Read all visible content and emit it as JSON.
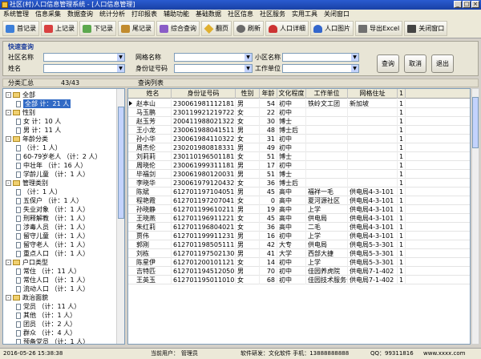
{
  "window": {
    "title": "社区(村)人口信息管理系统 - [人口信息管理]"
  },
  "menu": [
    "系统管理",
    "信息采集",
    "数据查询",
    "统计分析",
    "打印报表",
    "辅助功能",
    "基础数据",
    "社区信息",
    "社区服务",
    "实用工具",
    "关闭窗口"
  ],
  "toolbar": [
    "首记录",
    "上记录",
    "下记录",
    "尾记录",
    "综合查询",
    "翻页",
    "刷新",
    "人口详细",
    "人口图片",
    "导出Excel",
    "关闭窗口"
  ],
  "search": {
    "legend": "快速查询",
    "fields": [
      {
        "label": "社区名称",
        "value": ""
      },
      {
        "label": "姓名",
        "value": ""
      },
      {
        "label": "网格名称",
        "value": ""
      },
      {
        "label": "身份证号码",
        "value": ""
      },
      {
        "label": "小区名称",
        "value": ""
      },
      {
        "label": "工作单位",
        "value": ""
      }
    ],
    "buttons": [
      "查询",
      "取消",
      "退出"
    ]
  },
  "stats": {
    "tree_title": "分类汇总",
    "count": "43/43",
    "list_title": "查询列表"
  },
  "tree": [
    {
      "t": "全部",
      "lvl": 0,
      "kind": "folder",
      "exp": "-"
    },
    {
      "t": "全部    计：21 人",
      "lvl": 1,
      "kind": "page",
      "sel": true
    },
    {
      "t": "性别",
      "lvl": 0,
      "kind": "folder",
      "exp": "-"
    },
    {
      "t": "女   计：10 人",
      "lvl": 1,
      "kind": "page"
    },
    {
      "t": "男   计：11 人",
      "lvl": 1,
      "kind": "page"
    },
    {
      "t": "年龄分类",
      "lvl": 0,
      "kind": "folder",
      "exp": "-"
    },
    {
      "t": "（计：1 人）",
      "lvl": 1,
      "kind": "page"
    },
    {
      "t": "60-79岁老人 （计：2 人）",
      "lvl": 1,
      "kind": "page"
    },
    {
      "t": "中壮年  （计：16 人）",
      "lvl": 1,
      "kind": "page"
    },
    {
      "t": "学龄儿童  （计：1 人）",
      "lvl": 1,
      "kind": "page"
    },
    {
      "t": "管理类别",
      "lvl": 0,
      "kind": "folder",
      "exp": "-"
    },
    {
      "t": "（计：1 人）",
      "lvl": 1,
      "kind": "page"
    },
    {
      "t": "五保户 （计：1 人）",
      "lvl": 1,
      "kind": "page"
    },
    {
      "t": "失业对象 （计：1 人）",
      "lvl": 1,
      "kind": "page"
    },
    {
      "t": "刑释解教 （计：1 人）",
      "lvl": 1,
      "kind": "page"
    },
    {
      "t": "涉毒人员 （计：1 人）",
      "lvl": 1,
      "kind": "page"
    },
    {
      "t": "留守儿童 （计：1 人）",
      "lvl": 1,
      "kind": "page"
    },
    {
      "t": "留守老人 （计：1 人）",
      "lvl": 1,
      "kind": "page"
    },
    {
      "t": "重点人口 （计：1 人）",
      "lvl": 1,
      "kind": "page"
    },
    {
      "t": "户口类型",
      "lvl": 0,
      "kind": "folder",
      "exp": "-"
    },
    {
      "t": "常住 （计：11 人）",
      "lvl": 1,
      "kind": "page"
    },
    {
      "t": "常住人口 （计：1 人）",
      "lvl": 1,
      "kind": "page"
    },
    {
      "t": "流动人口 （计：1 人）",
      "lvl": 1,
      "kind": "page"
    },
    {
      "t": "政治面貌",
      "lvl": 0,
      "kind": "folder",
      "exp": "-"
    },
    {
      "t": "党员 （计：11 人）",
      "lvl": 1,
      "kind": "page"
    },
    {
      "t": "其他 （计：1 人）",
      "lvl": 1,
      "kind": "page"
    },
    {
      "t": "团员 （计：2 人）",
      "lvl": 1,
      "kind": "page"
    },
    {
      "t": "群众 （计：4 人）",
      "lvl": 1,
      "kind": "page"
    },
    {
      "t": "预备党员 （计：1 人）",
      "lvl": 1,
      "kind": "page"
    },
    {
      "t": "文化程度",
      "lvl": 0,
      "kind": "folder",
      "exp": "+"
    }
  ],
  "grid": {
    "columns": [
      "姓名",
      "身份证号码",
      "性别",
      "年龄",
      "文化程度",
      "工作单位",
      "网格住址",
      "1"
    ],
    "rows": [
      [
        "赵本山",
        "230061981112181",
        "男",
        "54",
        "初中",
        "铁岭文工团",
        "新加坡",
        "1"
      ],
      [
        "马玉鹏",
        "230119921219722",
        "女",
        "22",
        "初中",
        "",
        "",
        "1"
      ],
      [
        "赵玉芳",
        "200411988021322",
        "女",
        "30",
        "博士",
        "",
        "",
        "1"
      ],
      [
        "王小龙",
        "230061988041511",
        "男",
        "48",
        "博士后",
        "",
        "",
        "1"
      ],
      [
        "孙小华",
        "230061984110322",
        "女",
        "31",
        "初中",
        "",
        "",
        "1"
      ],
      [
        "周杰伦",
        "230201980818331",
        "男",
        "49",
        "初中",
        "",
        "",
        "1"
      ],
      [
        "刘莉莉",
        "230110196501181",
        "女",
        "51",
        "博士",
        "",
        "",
        "1"
      ],
      [
        "周晓伦",
        "230061999311181",
        "男",
        "17",
        "初中",
        "",
        "",
        "1"
      ],
      [
        "毕福剑",
        "230061980120031",
        "男",
        "51",
        "博士",
        "",
        "",
        "1"
      ],
      [
        "李晓华",
        "230061979120432",
        "女",
        "36",
        "博士后",
        "",
        "",
        "1"
      ],
      [
        "陈斌",
        "612701197104051",
        "男",
        "45",
        "高中",
        "福祥一毛",
        "供电局4-3-101",
        "1"
      ],
      [
        "程艳霞",
        "612701197207041",
        "女",
        "0",
        "高中",
        "夏河源社区",
        "供电局4-3-101",
        "1"
      ],
      [
        "孙晓静",
        "612701199610211",
        "男",
        "19",
        "高中",
        "上学",
        "供电局4-3-101",
        "1"
      ],
      [
        "王晓燕",
        "612701196911221",
        "女",
        "45",
        "高中",
        "供电局",
        "供电局4-3-101",
        "1"
      ],
      [
        "朱红莉",
        "612701196804021",
        "女",
        "36",
        "高中",
        "二毛",
        "供电局4-3-101",
        "1"
      ],
      [
        "贾伟",
        "612701199911231",
        "男",
        "16",
        "初中",
        "上学",
        "供电局4-3-101",
        "1"
      ],
      [
        "郭刚",
        "612701198505111",
        "男",
        "42",
        "大专",
        "供电局",
        "供电局5-3-301",
        "1"
      ],
      [
        "刘栋",
        "612701197502130",
        "男",
        "41",
        "大学",
        "西部大捷",
        "供电局5-3-301",
        "1"
      ],
      [
        "陈星伊",
        "612701200101121",
        "女",
        "14",
        "初中",
        "上学",
        "供电局5-3-301",
        "1"
      ],
      [
        "吉特匹",
        "612701194512050",
        "男",
        "70",
        "初中",
        "佳园养虎院",
        "供电局7-1-402",
        "1"
      ],
      [
        "王英玉",
        "612701195011010",
        "女",
        "68",
        "初中",
        "佳园技术服务公司",
        "供电局7-1-402",
        "1"
      ]
    ]
  },
  "status": {
    "date": "2016-05-26 15:38:38",
    "user_label": "当前用户：",
    "user": "管理员",
    "dev": "软件研发：文化软件  手机：13888888888",
    "qq": "QQ：99311816",
    "site": "www.xxxx.com"
  },
  "colors": {
    "title": "#1941a5",
    "accent": "#316ac5"
  }
}
